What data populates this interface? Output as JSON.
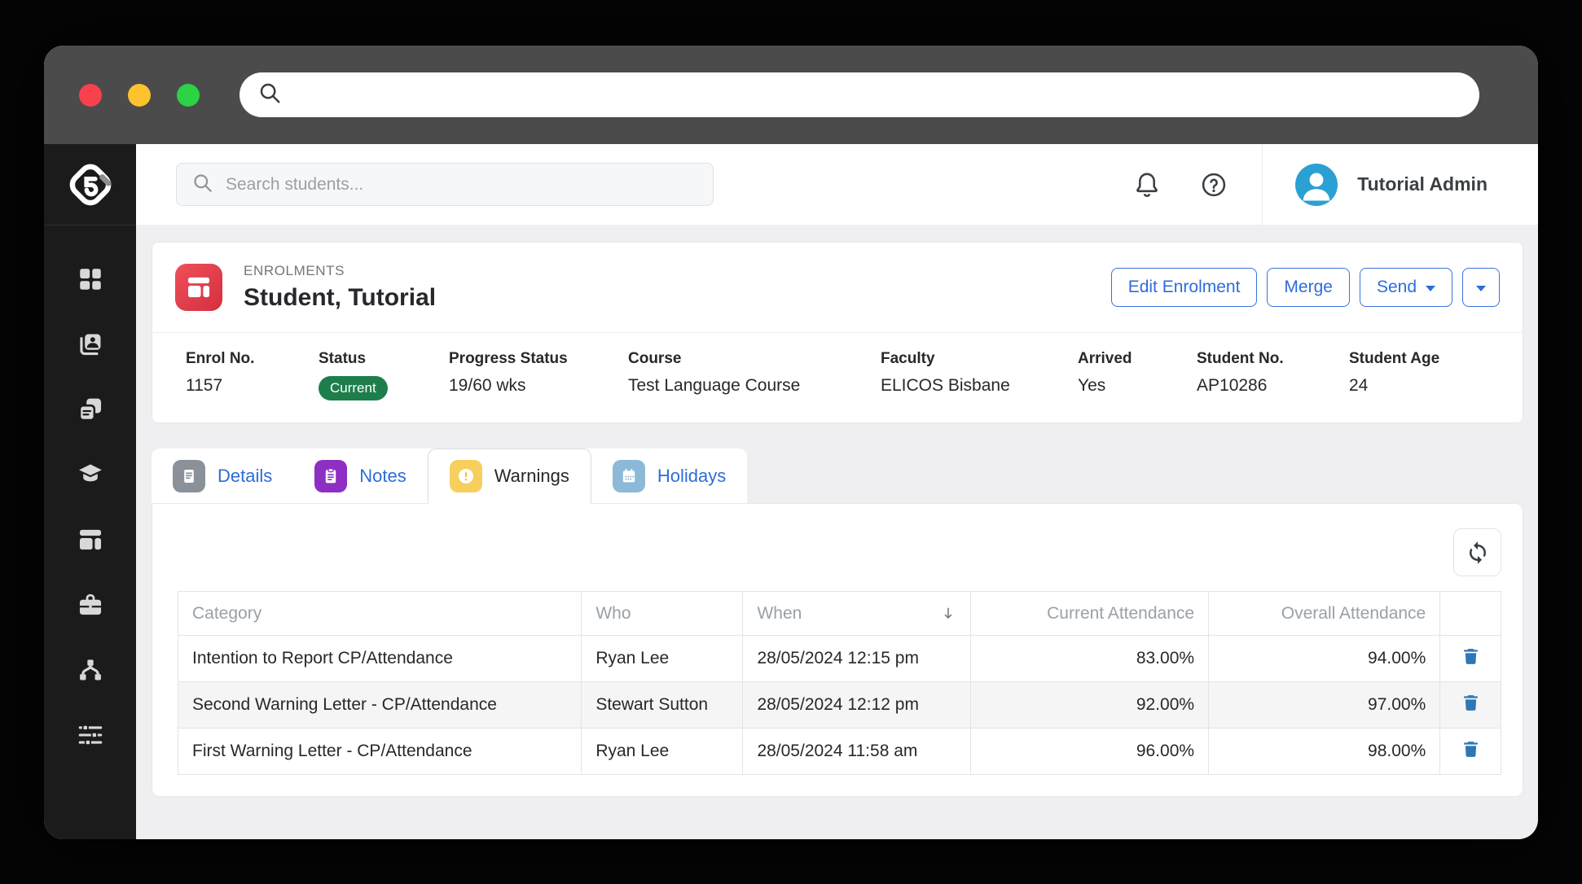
{
  "chrome": {
    "url_value": "",
    "traffic_lights": [
      "close",
      "minimize",
      "zoom"
    ]
  },
  "app_header": {
    "search": {
      "placeholder": "Search students..."
    },
    "icons": [
      "bell-icon",
      "help-icon"
    ],
    "user": {
      "name": "Tutorial Admin",
      "avatar_color": "#2aa0d3"
    }
  },
  "sidebar": {
    "logo": "app-logo",
    "icons": [
      "dashboard-grid-icon",
      "student-card-icon",
      "documents-icon",
      "graduation-cap-icon",
      "layout-icon",
      "briefcase-icon",
      "nodes-icon",
      "sliders-icon"
    ]
  },
  "enrolment": {
    "section_label": "ENROLMENTS",
    "title": "Student, Tutorial",
    "actions": {
      "edit": "Edit Enrolment",
      "merge": "Merge",
      "send": "Send"
    },
    "fields": [
      {
        "label": "Enrol No.",
        "value": "1157"
      },
      {
        "label": "Status",
        "value": "Current"
      },
      {
        "label": "Progress Status",
        "value": "19/60 wks"
      },
      {
        "label": "Course",
        "value": "Test Language Course"
      },
      {
        "label": "Faculty",
        "value": "ELICOS Bisbane"
      },
      {
        "label": "Arrived",
        "value": "Yes"
      },
      {
        "label": "Student No.",
        "value": "AP10286"
      },
      {
        "label": "Student Age",
        "value": "24"
      }
    ]
  },
  "tabs": [
    {
      "label": "Details",
      "icon": "document-icon",
      "icon_color": "#8a9199",
      "active": false
    },
    {
      "label": "Notes",
      "icon": "clipboard-icon",
      "icon_color": "#8e2fc4",
      "active": false
    },
    {
      "label": "Warnings",
      "icon": "warning-icon",
      "icon_color": "#f6cf5d",
      "active": true
    },
    {
      "label": "Holidays",
      "icon": "calendar-icon",
      "icon_color": "#8cb9d8",
      "active": false
    }
  ],
  "warnings_table": {
    "columns": [
      "Category",
      "Who",
      "When",
      "Current Attendance",
      "Overall Attendance"
    ],
    "sorted_column": "When",
    "sort_direction": "desc",
    "rows": [
      {
        "category": "Intention to Report CP/Attendance",
        "who": "Ryan Lee",
        "when": "28/05/2024 12:15 pm",
        "current": "83.00%",
        "overall": "94.00%"
      },
      {
        "category": "Second Warning Letter - CP/Attendance",
        "who": "Stewart Sutton",
        "when": "28/05/2024 12:12 pm",
        "current": "92.00%",
        "overall": "97.00%"
      },
      {
        "category": "First Warning Letter - CP/Attendance",
        "who": "Ryan Lee",
        "when": "28/05/2024 11:58 am",
        "current": "96.00%",
        "overall": "98.00%"
      }
    ]
  },
  "colors": {
    "accent_blue": "#2e6cd9",
    "status_green": "#1d7e4b",
    "enrolments_red": "#d42f3f",
    "avatar_blue": "#2aa0d3",
    "trash_blue": "#2e77b5",
    "sidebar_bg": "#1b1b1c",
    "chrome_bg": "#4b4b4b"
  }
}
